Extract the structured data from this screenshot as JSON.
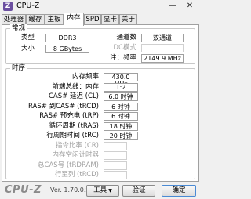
{
  "window": {
    "title": "CPU-Z",
    "logo_letter": "Z",
    "minimize": "—",
    "close": "✕"
  },
  "tabs": [
    "处理器",
    "缓存",
    "主板",
    "内存",
    "SPD",
    "显卡",
    "关于"
  ],
  "active_tab": "内存",
  "general": {
    "title": "常规",
    "type_label": "类型",
    "type_value": "DDR3",
    "size_label": "大小",
    "size_value": "8 GBytes",
    "channels_label": "通道数",
    "channels_value": "双通道",
    "dc_mode_label": "DC模式",
    "dc_mode_value": "",
    "nb_freq_label": "注：频率",
    "nb_freq_value": "2149.9 MHz"
  },
  "timings": {
    "title": "时序",
    "rows": [
      {
        "label": "内存频率",
        "value": "430.0 MHz",
        "enabled": true
      },
      {
        "label": "前端总线：内存",
        "value": "1:2",
        "enabled": true
      },
      {
        "label": "CAS# 延迟 (CL)",
        "value": "6.0 时钟",
        "enabled": true
      },
      {
        "label": "RAS# 到CAS# (tRCD)",
        "value": "6 时钟",
        "enabled": true
      },
      {
        "label": "RAS# 预充电 (tRP)",
        "value": "6 时钟",
        "enabled": true
      },
      {
        "label": "循环周期 (tRAS)",
        "value": "18 时钟",
        "enabled": true
      },
      {
        "label": "行周期时间 (tRC)",
        "value": "20 时钟",
        "enabled": true
      },
      {
        "label": "指令比率 (CR)",
        "value": "",
        "enabled": false
      },
      {
        "label": "内存空闲计时器",
        "value": "",
        "enabled": false
      },
      {
        "label": "总CAS号 (tRDRAM)",
        "value": "",
        "enabled": false
      },
      {
        "label": "行至列 (tRCD)",
        "value": "",
        "enabled": false
      }
    ]
  },
  "footer": {
    "brand": "CPU-Z",
    "version": "Ver. 1.70.0.x64",
    "tools_label": "工具",
    "tools_caret": "▼",
    "verify_label": "验证",
    "ok_label": "确定"
  },
  "colors": {
    "logo": "#6b4fa0",
    "brand": "#8a8a8a",
    "ok_border": "#4a8ad4"
  }
}
